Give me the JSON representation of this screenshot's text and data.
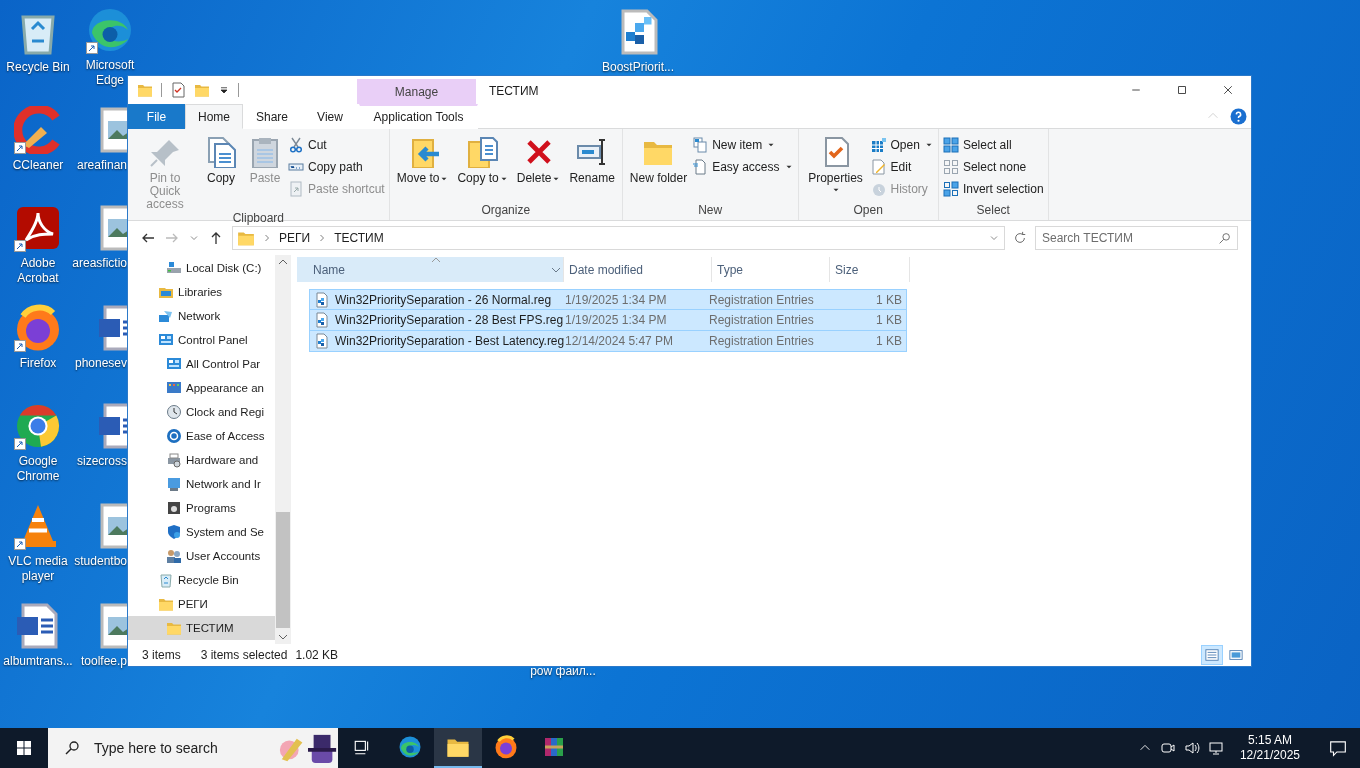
{
  "desktop": {
    "icons": [
      {
        "label": "Recycle Bin",
        "kind": "recycle-bin",
        "shortcut": false
      },
      {
        "label": "CCleaner",
        "kind": "broom",
        "shortcut": true
      },
      {
        "label": "Adobe Acrobat",
        "kind": "acrobat",
        "shortcut": true
      },
      {
        "label": "Firefox",
        "kind": "firefox",
        "shortcut": true
      },
      {
        "label": "Google Chrome",
        "kind": "chrome",
        "shortcut": true
      },
      {
        "label": "VLC media player",
        "kind": "cone",
        "shortcut": true
      },
      {
        "label": "albumtrans...",
        "kind": "word-document",
        "shortcut": false
      },
      {
        "label": "Microsoft Edge",
        "kind": "edge",
        "shortcut": true
      },
      {
        "label": "areafinan",
        "kind": "image-file",
        "shortcut": false
      },
      {
        "label": "areasfictio",
        "kind": "image-file",
        "shortcut": false
      },
      {
        "label": "phonesev",
        "kind": "word-document",
        "shortcut": false
      },
      {
        "label": "sizecross",
        "kind": "word-document",
        "shortcut": false
      },
      {
        "label": "studentbo",
        "kind": "image-file",
        "shortcut": false
      },
      {
        "label": "toolfee.p",
        "kind": "image-file",
        "shortcut": false
      },
      {
        "label": "BoostPriorit...",
        "kind": "registry",
        "shortcut": false
      },
      {
        "label": "pow файл...",
        "kind": "label-only",
        "shortcut": false
      }
    ]
  },
  "explorer": {
    "title": "ТЕСТИМ",
    "context_group": "Manage",
    "tabs": [
      {
        "label": "File",
        "kind": "file",
        "selected": false
      },
      {
        "label": "Home",
        "kind": "tab",
        "selected": true
      },
      {
        "label": "Share",
        "kind": "tab",
        "selected": false
      },
      {
        "label": "View",
        "kind": "tab",
        "selected": false
      },
      {
        "label": "Application Tools",
        "kind": "context",
        "selected": false
      }
    ],
    "ribbon": [
      {
        "label": "Clipboard",
        "items": [
          {
            "label": "Pin to Quick access",
            "kind": "large",
            "disabled": true,
            "dropdown": false
          },
          {
            "label": "Copy",
            "kind": "large",
            "disabled": false,
            "dropdown": false
          },
          {
            "label": "Paste",
            "kind": "large",
            "disabled": true,
            "dropdown": false
          },
          {
            "label": "Cut",
            "kind": "small",
            "disabled": false,
            "dropdown": false
          },
          {
            "label": "Copy path",
            "kind": "small",
            "disabled": false,
            "dropdown": false
          },
          {
            "label": "Paste shortcut",
            "kind": "small",
            "disabled": true,
            "dropdown": false
          }
        ]
      },
      {
        "label": "Organize",
        "items": [
          {
            "label": "Move to",
            "kind": "large",
            "disabled": false,
            "dropdown": true
          },
          {
            "label": "Copy to",
            "kind": "large",
            "disabled": false,
            "dropdown": true
          },
          {
            "label": "Delete",
            "kind": "large",
            "disabled": false,
            "dropdown": true
          },
          {
            "label": "Rename",
            "kind": "large",
            "disabled": false,
            "dropdown": false
          }
        ]
      },
      {
        "label": "New",
        "items": [
          {
            "label": "New folder",
            "kind": "large",
            "disabled": false,
            "dropdown": false
          },
          {
            "label": "New item",
            "kind": "small",
            "disabled": false,
            "dropdown": true
          },
          {
            "label": "Easy access",
            "kind": "small",
            "disabled": false,
            "dropdown": true
          }
        ]
      },
      {
        "label": "Open",
        "items": [
          {
            "label": "Properties",
            "kind": "large",
            "disabled": false,
            "dropdown": true
          },
          {
            "label": "Open",
            "kind": "small",
            "disabled": false,
            "dropdown": true
          },
          {
            "label": "Edit",
            "kind": "small",
            "disabled": false,
            "dropdown": false
          },
          {
            "label": "History",
            "kind": "small",
            "disabled": true,
            "dropdown": false
          }
        ]
      },
      {
        "label": "Select",
        "items": [
          {
            "label": "Select all",
            "kind": "small",
            "disabled": false,
            "dropdown": false
          },
          {
            "label": "Select none",
            "kind": "small",
            "disabled": false,
            "dropdown": false
          },
          {
            "label": "Invert selection",
            "kind": "small",
            "disabled": false,
            "dropdown": false
          }
        ]
      }
    ],
    "path": [
      "РЕГИ",
      "ТЕСТИМ"
    ],
    "search": {
      "placeholder": "Search ТЕСТИМ"
    },
    "nav": [
      {
        "children": [
          {
            "label": "Local Disk (C:)",
            "kind": "drive",
            "selected": false
          }
        ]
      },
      {
        "label": "Libraries",
        "kind": "library",
        "selected": false
      },
      {
        "label": "Network",
        "kind": "network",
        "selected": false
      },
      {
        "label": "Control Panel",
        "kind": "panel",
        "selected": false,
        "children": [
          {
            "label": "All Control Par",
            "kind": "panel",
            "selected": false
          },
          {
            "label": "Appearance an",
            "kind": "palette",
            "selected": false
          },
          {
            "label": "Clock and Regi",
            "kind": "clock",
            "selected": false
          },
          {
            "label": "Ease of Access",
            "kind": "access",
            "selected": false
          },
          {
            "label": "Hardware and",
            "kind": "printer",
            "selected": false
          },
          {
            "label": "Network and Ir",
            "kind": "globe",
            "selected": false
          },
          {
            "label": "Programs",
            "kind": "programs",
            "selected": false
          },
          {
            "label": "System and Se",
            "kind": "shield",
            "selected": false
          },
          {
            "label": "User Accounts",
            "kind": "users",
            "selected": false
          }
        ]
      },
      {
        "label": "Recycle Bin",
        "kind": "recycle-bin",
        "selected": false
      },
      {
        "label": "РЕГИ",
        "kind": "folder",
        "selected": false,
        "children": [
          {
            "label": "ТЕСТИМ",
            "kind": "folder",
            "selected": true
          }
        ]
      }
    ],
    "columns": [
      "Name",
      "Date modified",
      "Type",
      "Size"
    ],
    "rows": [
      {
        "name": "Win32PrioritySeparation - 26 Normal.reg",
        "date": "1/19/2025 1:34 PM",
        "type": "Registration Entries",
        "size": "1 KB",
        "selected": true
      },
      {
        "name": "Win32PrioritySeparation - 28 Best FPS.reg",
        "date": "1/19/2025 1:34 PM",
        "type": "Registration Entries",
        "size": "1 KB",
        "selected": true
      },
      {
        "name": "Win32PrioritySeparation - Best Latency.reg",
        "date": "12/14/2024 5:47 PM",
        "type": "Registration Entries",
        "size": "1 KB",
        "selected": true
      }
    ],
    "status": [
      "3 items",
      "3 items selected",
      "1.02 KB"
    ],
    "views": [
      {
        "kind": "details",
        "selected": true
      },
      {
        "kind": "large-icons",
        "selected": false
      }
    ]
  },
  "taskbar": {
    "search_placeholder": "Type here to search",
    "apps": [
      {
        "kind": "task-view",
        "active": false
      },
      {
        "kind": "edge",
        "active": false
      },
      {
        "kind": "folder",
        "active": true
      },
      {
        "kind": "firefox",
        "active": false
      },
      {
        "kind": "archive",
        "active": false
      }
    ],
    "time": "5:15 AM",
    "date": "12/21/2025"
  }
}
